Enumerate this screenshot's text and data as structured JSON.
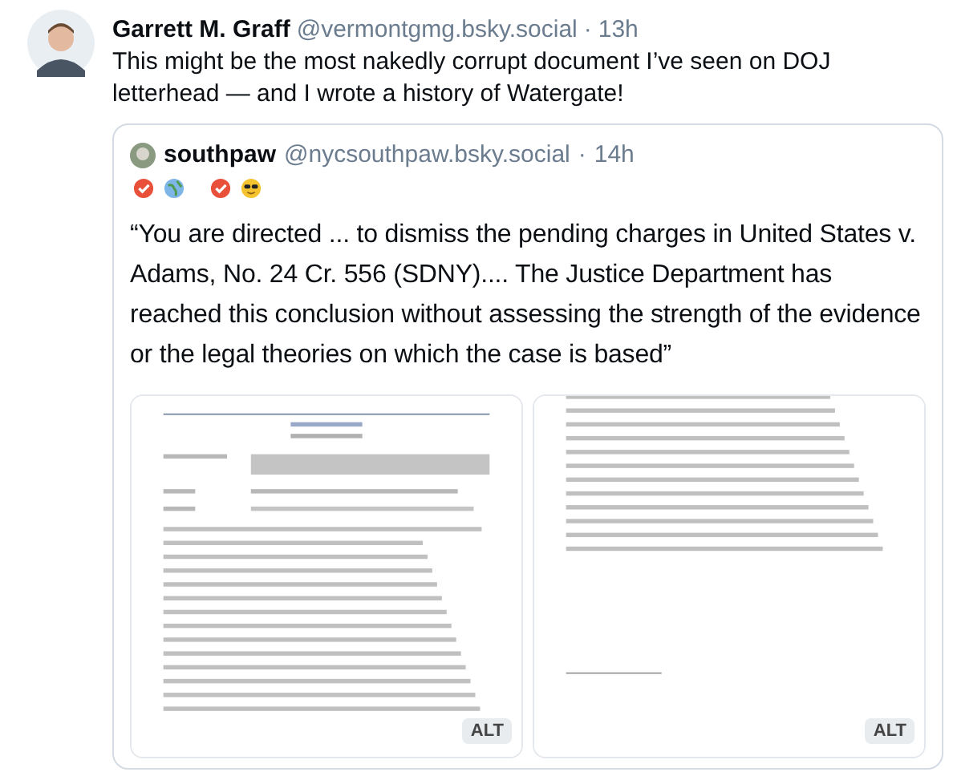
{
  "post": {
    "author": "Garrett M. Graff",
    "handle": "@vermontgmg.bsky.social",
    "separator": "·",
    "time": "13h",
    "text": "This might be the most nakedly corrupt document I’ve seen on DOJ letterhead — and I wrote a history of Watergate!"
  },
  "quote": {
    "author": "southpaw",
    "handle": "@nycsouthpaw.bsky.social",
    "separator": "·",
    "time": "14h",
    "text": "“You are directed ... to dismiss the pending charges in United States v. Adams, No. 24 Cr. 556 (SDNY).... The Justice Department has reached this conclusion without assessing the strength of the evidence or the legal theories on which the case is based”",
    "images": [
      {
        "kind": "picture",
        "alt_badge": "ALT"
      },
      {
        "kind": "picture",
        "alt_badge": "ALT"
      }
    ]
  }
}
